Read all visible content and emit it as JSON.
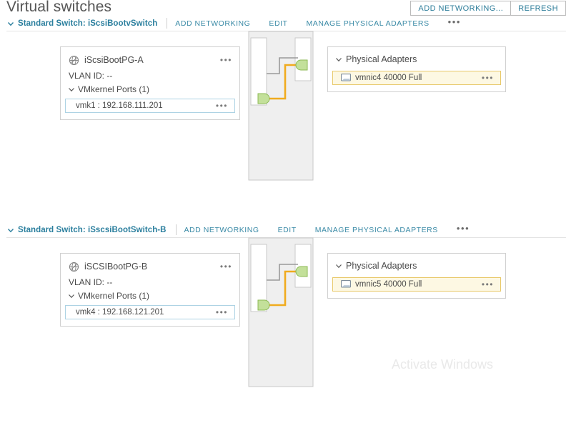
{
  "page": {
    "title": "Virtual switches",
    "watermark": "Activate Windows"
  },
  "header_actions": [
    {
      "label": "ADD NETWORKING...",
      "name": "add-networking-button"
    },
    {
      "label": "REFRESH",
      "name": "refresh-button"
    }
  ],
  "switch_actions": {
    "add_networking": "ADD NETWORKING",
    "edit": "EDIT",
    "manage_physical_adapters": "MANAGE PHYSICAL ADAPTERS",
    "more": "•••"
  },
  "row_more": "•••",
  "colors": {
    "link": "#2b7f9e",
    "action": "#3a8aa6",
    "text": "#4a4a4a",
    "box_border": "#d0d0d0",
    "vmk_border": "#add3e4",
    "adapter_border": "#e8c96a",
    "adapter_bg": "#fdf8e3",
    "connector_line": "#f0ab1e",
    "connector_gray": "#9a9a9a",
    "connector_fill": "#efefef",
    "nub_fill": "#c3e09a",
    "watermark": "#e9e9e9"
  },
  "switches": [
    {
      "name": "Standard Switch: iScsiBootvSwitch",
      "port_group": {
        "name": "iScsiBootPG-A",
        "vlan_label": "VLAN ID: --",
        "vmkernel_ports_label": "VMkernel Ports (1)",
        "ports": [
          {
            "label": "vmk1 : 192.168.111.201"
          }
        ]
      },
      "physical_adapters": {
        "title": "Physical Adapters",
        "adapters": [
          {
            "label": "vmnic4 40000 Full"
          }
        ]
      }
    },
    {
      "name": "Standard Switch: iSscsiBootSwitch-B",
      "port_group": {
        "name": "iSCSIBootPG-B",
        "vlan_label": "VLAN ID: --",
        "vmkernel_ports_label": "VMkernel Ports (1)",
        "ports": [
          {
            "label": "vmk4 : 192.168.121.201"
          }
        ]
      },
      "physical_adapters": {
        "title": "Physical Adapters",
        "adapters": [
          {
            "label": "vmnic5 40000 Full"
          }
        ]
      }
    }
  ]
}
